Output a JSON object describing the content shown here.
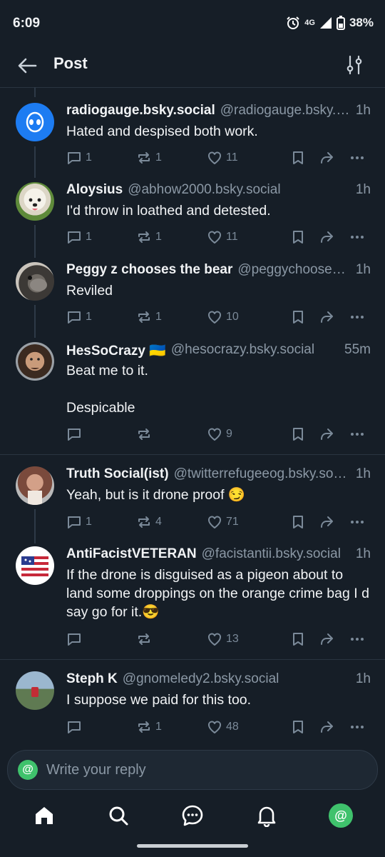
{
  "status_bar": {
    "time": "6:09",
    "network": "4G",
    "battery": "38%"
  },
  "header": {
    "title": "Post"
  },
  "posts": [
    {
      "name": "radiogauge.bsky.social",
      "handle": "@radiogauge.bsky.social",
      "time": "1h",
      "text": "Hated and despised both work.",
      "replies": "1",
      "reposts": "1",
      "likes": "11"
    },
    {
      "name": "Aloysius",
      "handle": "@abhow2000.bsky.social",
      "time": "1h",
      "text": "I'd throw in loathed and detested.",
      "replies": "1",
      "reposts": "1",
      "likes": "11"
    },
    {
      "name": "Peggy z chooses the bear",
      "handle": "@peggychooses.bsky.social",
      "time": "1h",
      "text": "Reviled",
      "replies": "1",
      "reposts": "1",
      "likes": "10"
    },
    {
      "name": "HesSoCrazy 🇺🇦",
      "handle": "@hesocrazy.bsky.social",
      "time": "55m",
      "text": "Beat me to it.\n\nDespicable",
      "replies": "",
      "reposts": "",
      "likes": "9"
    },
    {
      "name": "Truth Social(ist)",
      "handle": "@twitterrefugeeog.bsky.social",
      "time": "1h",
      "text": "Yeah, but is it drone proof 😏",
      "replies": "1",
      "reposts": "4",
      "likes": "71"
    },
    {
      "name": "AntiFacistVETERAN",
      "handle": "@facistantii.bsky.social",
      "time": "1h",
      "text": "If the drone is disguised as a pigeon about to land some droppings on the orange crime bag I d say go for it.😎",
      "replies": "",
      "reposts": "",
      "likes": "13"
    },
    {
      "name": "Steph K",
      "handle": "@gnomeledy2.bsky.social",
      "time": "1h",
      "text": "I suppose we paid for this too.",
      "replies": "",
      "reposts": "1",
      "likes": "48"
    }
  ],
  "composer": {
    "placeholder": "Write your reply"
  },
  "tabs": [
    "home",
    "search",
    "chat",
    "notifications",
    "profile"
  ],
  "colors": {
    "background": "#161e27",
    "accent": "#1d7cf2",
    "muted": "#7b8a99",
    "profile_green": "#3fc26c"
  }
}
